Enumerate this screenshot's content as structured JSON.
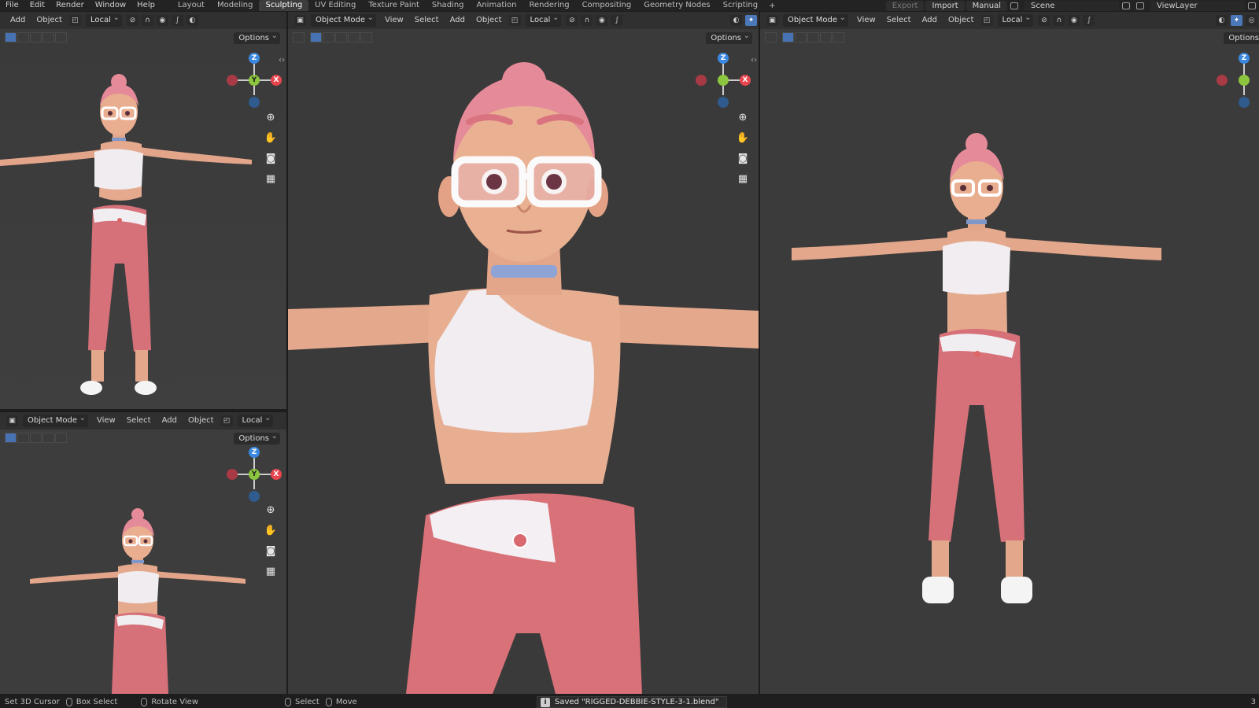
{
  "topbar": {
    "menus": [
      "File",
      "Edit",
      "Render",
      "Window",
      "Help"
    ],
    "tabs": [
      "Layout",
      "Modeling",
      "Sculpting",
      "UV Editing",
      "Texture Paint",
      "Shading",
      "Animation",
      "Rendering",
      "Compositing",
      "Geometry Nodes",
      "Scripting"
    ],
    "active_tab": "Sculpting",
    "export_label": "Export",
    "import_label": "Import",
    "manual_label": "Manual",
    "scene_label": "Scene",
    "viewlayer_label": "ViewLayer"
  },
  "viewport_header": {
    "mode": "Object Mode",
    "view": "View",
    "select": "Select",
    "add": "Add",
    "object": "Object",
    "orientation": "Local",
    "options": "Options"
  },
  "gizmo": {
    "x": "X",
    "y": "Y",
    "z": "Z"
  },
  "colors": {
    "viewport_bg": "#3d3d3d",
    "header_bg": "#303030",
    "accent_blue": "#4772b3",
    "axis_x": "#e8464f",
    "axis_y": "#8cc63f",
    "axis_z": "#3a88e0",
    "skin": "#e8a98a",
    "hair": "#e58a98",
    "pants": "#d97077",
    "top": "#f1eef2"
  },
  "status": {
    "items": [
      "Set 3D Cursor",
      "Box Select",
      "Rotate View",
      "Select",
      "Move"
    ],
    "saved_message": "Saved \"RIGGED-DEBBIE-STYLE-3-1.blend\"",
    "version": "3"
  }
}
